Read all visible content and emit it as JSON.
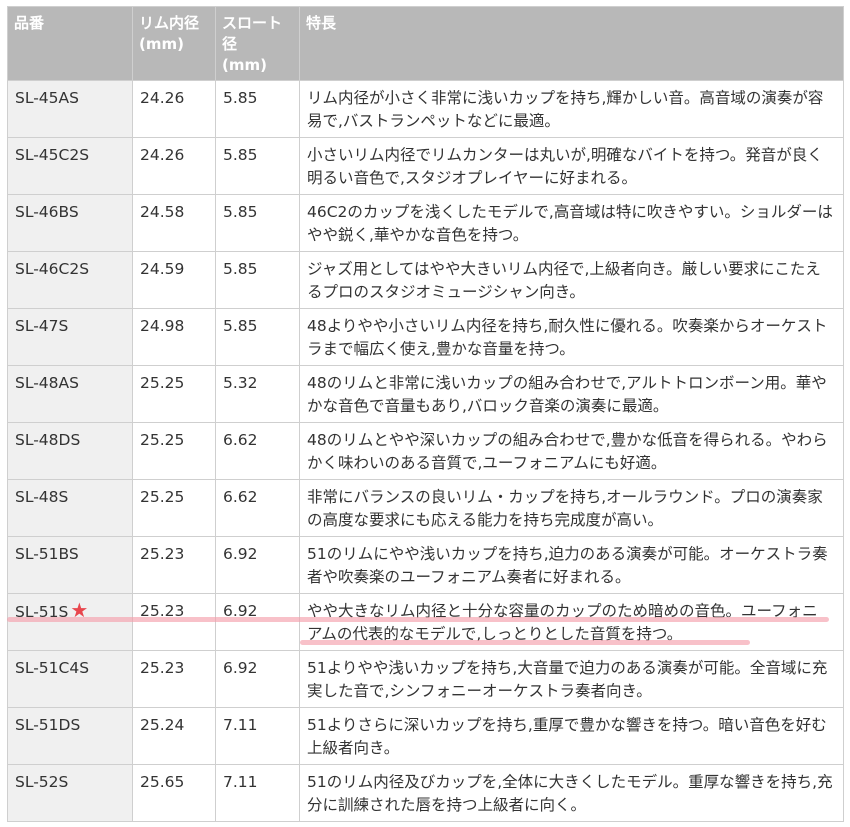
{
  "headers": {
    "model": "品番",
    "rim": "リム内径\n(mm)",
    "throat": "スロート径\n(mm)",
    "feature": "特長"
  },
  "rows": [
    {
      "model": "SL-45AS",
      "rim": "24.26",
      "throat": "5.85",
      "feature": "リム内径が小さく非常に浅いカップを持ち,輝かしい音。高音域の演奏が容易で,バストランペットなどに最適。"
    },
    {
      "model": "SL-45C2S",
      "rim": "24.26",
      "throat": "5.85",
      "feature": "小さいリム内径でリムカンターは丸いが,明確なバイトを持つ。発音が良く明るい音色で,スタジオプレイヤーに好まれる。"
    },
    {
      "model": "SL-46BS",
      "rim": "24.58",
      "throat": "5.85",
      "feature": "46C2のカップを浅くしたモデルで,高音域は特に吹きやすい。ショルダーはやや鋭く,華やかな音色を持つ。"
    },
    {
      "model": "SL-46C2S",
      "rim": "24.59",
      "throat": "5.85",
      "feature": "ジャズ用としてはやや大きいリム内径で,上級者向き。厳しい要求にこたえるプロのスタジオミュージシャン向き。"
    },
    {
      "model": "SL-47S",
      "rim": "24.98",
      "throat": "5.85",
      "feature": "48よりやや小さいリム内径を持ち,耐久性に優れる。吹奏楽からオーケストラまで幅広く使え,豊かな音量を持つ。"
    },
    {
      "model": "SL-48AS",
      "rim": "25.25",
      "throat": "5.32",
      "feature": "48のリムと非常に浅いカップの組み合わせで,アルトトロンボーン用。華やかな音色で音量もあり,バロック音楽の演奏に最適。"
    },
    {
      "model": "SL-48DS",
      "rim": "25.25",
      "throat": "6.62",
      "feature": "48のリムとやや深いカップの組み合わせで,豊かな低音を得られる。やわらかく味わいのある音質で,ユーフォニアムにも好適。"
    },
    {
      "model": "SL-48S",
      "rim": "25.25",
      "throat": "6.62",
      "feature": "非常にバランスの良いリム・カップを持ち,オールラウンド。プロの演奏家の高度な要求にも応える能力を持ち完成度が高い。"
    },
    {
      "model": "SL-51BS",
      "rim": "25.23",
      "throat": "6.92",
      "feature": "51のリムにやや浅いカップを持ち,迫力のある演奏が可能。オーケストラ奏者や吹奏楽のユーフォニアム奏者に好まれる。"
    },
    {
      "model": "SL-51S",
      "rim": "25.23",
      "throat": "6.92",
      "feature": "やや大きなリム内径と十分な容量のカップのため暗めの音色。ユーフォニアムの代表的なモデルで,しっとりとした音質を持つ。",
      "starred": true
    },
    {
      "model": "SL-51C4S",
      "rim": "25.23",
      "throat": "6.92",
      "feature": "51よりやや浅いカップを持ち,大音量で迫力のある演奏が可能。全音域に充実した音で,シンフォニーオーケストラ奏者向き。"
    },
    {
      "model": "SL-51DS",
      "rim": "25.24",
      "throat": "7.11",
      "feature": "51よりさらに深いカップを持ち,重厚で豊かな響きを持つ。暗い音色を好む上級者向き。"
    },
    {
      "model": "SL-52S",
      "rim": "25.65",
      "throat": "7.11",
      "feature": "51のリム内径及びカップを,全体に大きくしたモデル。重厚な響きを持ち,充分に訓練された唇を持つ上級者に向く。"
    }
  ],
  "star_symbol": "★",
  "colors": {
    "header_bg": "#b8b8b8",
    "model_col_bg": "#f0f0f0",
    "star": "#e8474e",
    "highlight": "#f4a0ac"
  }
}
